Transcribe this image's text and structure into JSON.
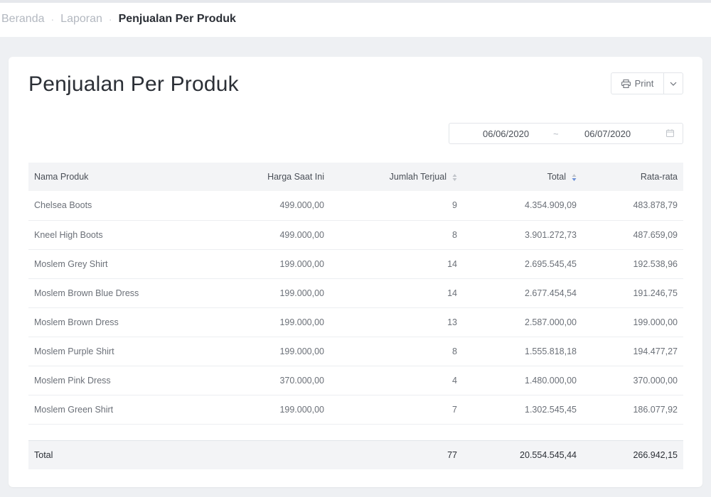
{
  "breadcrumb": {
    "items": [
      {
        "label": "Beranda"
      },
      {
        "label": "Laporan"
      },
      {
        "label": "Penjualan Per Produk"
      }
    ]
  },
  "page": {
    "title": "Penjualan Per Produk",
    "print_label": "Print"
  },
  "date_range": {
    "start": "06/06/2020",
    "separator": "~",
    "end": "06/07/2020"
  },
  "table": {
    "headers": {
      "name": "Nama Produk",
      "price": "Harga Saat Ini",
      "qty": "Jumlah Terjual",
      "total": "Total",
      "avg": "Rata-rata"
    },
    "rows": [
      {
        "name": "Chelsea Boots",
        "price": "499.000,00",
        "qty": "9",
        "total": "4.354.909,09",
        "avg": "483.878,79"
      },
      {
        "name": "Kneel High Boots",
        "price": "499.000,00",
        "qty": "8",
        "total": "3.901.272,73",
        "avg": "487.659,09"
      },
      {
        "name": "Moslem Grey Shirt",
        "price": "199.000,00",
        "qty": "14",
        "total": "2.695.545,45",
        "avg": "192.538,96"
      },
      {
        "name": "Moslem Brown Blue Dress",
        "price": "199.000,00",
        "qty": "14",
        "total": "2.677.454,54",
        "avg": "191.246,75"
      },
      {
        "name": "Moslem Brown Dress",
        "price": "199.000,00",
        "qty": "13",
        "total": "2.587.000,00",
        "avg": "199.000,00"
      },
      {
        "name": "Moslem Purple Shirt",
        "price": "199.000,00",
        "qty": "8",
        "total": "1.555.818,18",
        "avg": "194.477,27"
      },
      {
        "name": "Moslem Pink Dress",
        "price": "370.000,00",
        "qty": "4",
        "total": "1.480.000,00",
        "avg": "370.000,00"
      },
      {
        "name": "Moslem Green Shirt",
        "price": "199.000,00",
        "qty": "7",
        "total": "1.302.545,45",
        "avg": "186.077,92"
      }
    ],
    "footer": {
      "label": "Total",
      "qty": "77",
      "total": "20.554.545,44",
      "avg": "266.942,15"
    }
  },
  "icons": {
    "print": "printer-icon",
    "dropdown": "chevron-down-icon",
    "calendar": "calendar-icon",
    "sort": "sort-icon"
  },
  "colors": {
    "background": "#eef0f3",
    "card": "#ffffff",
    "table_header": "#f3f4f6",
    "text_dark": "#2b2f36",
    "text_muted": "#6b7078",
    "breadcrumb_inactive": "#b3b8c0"
  }
}
